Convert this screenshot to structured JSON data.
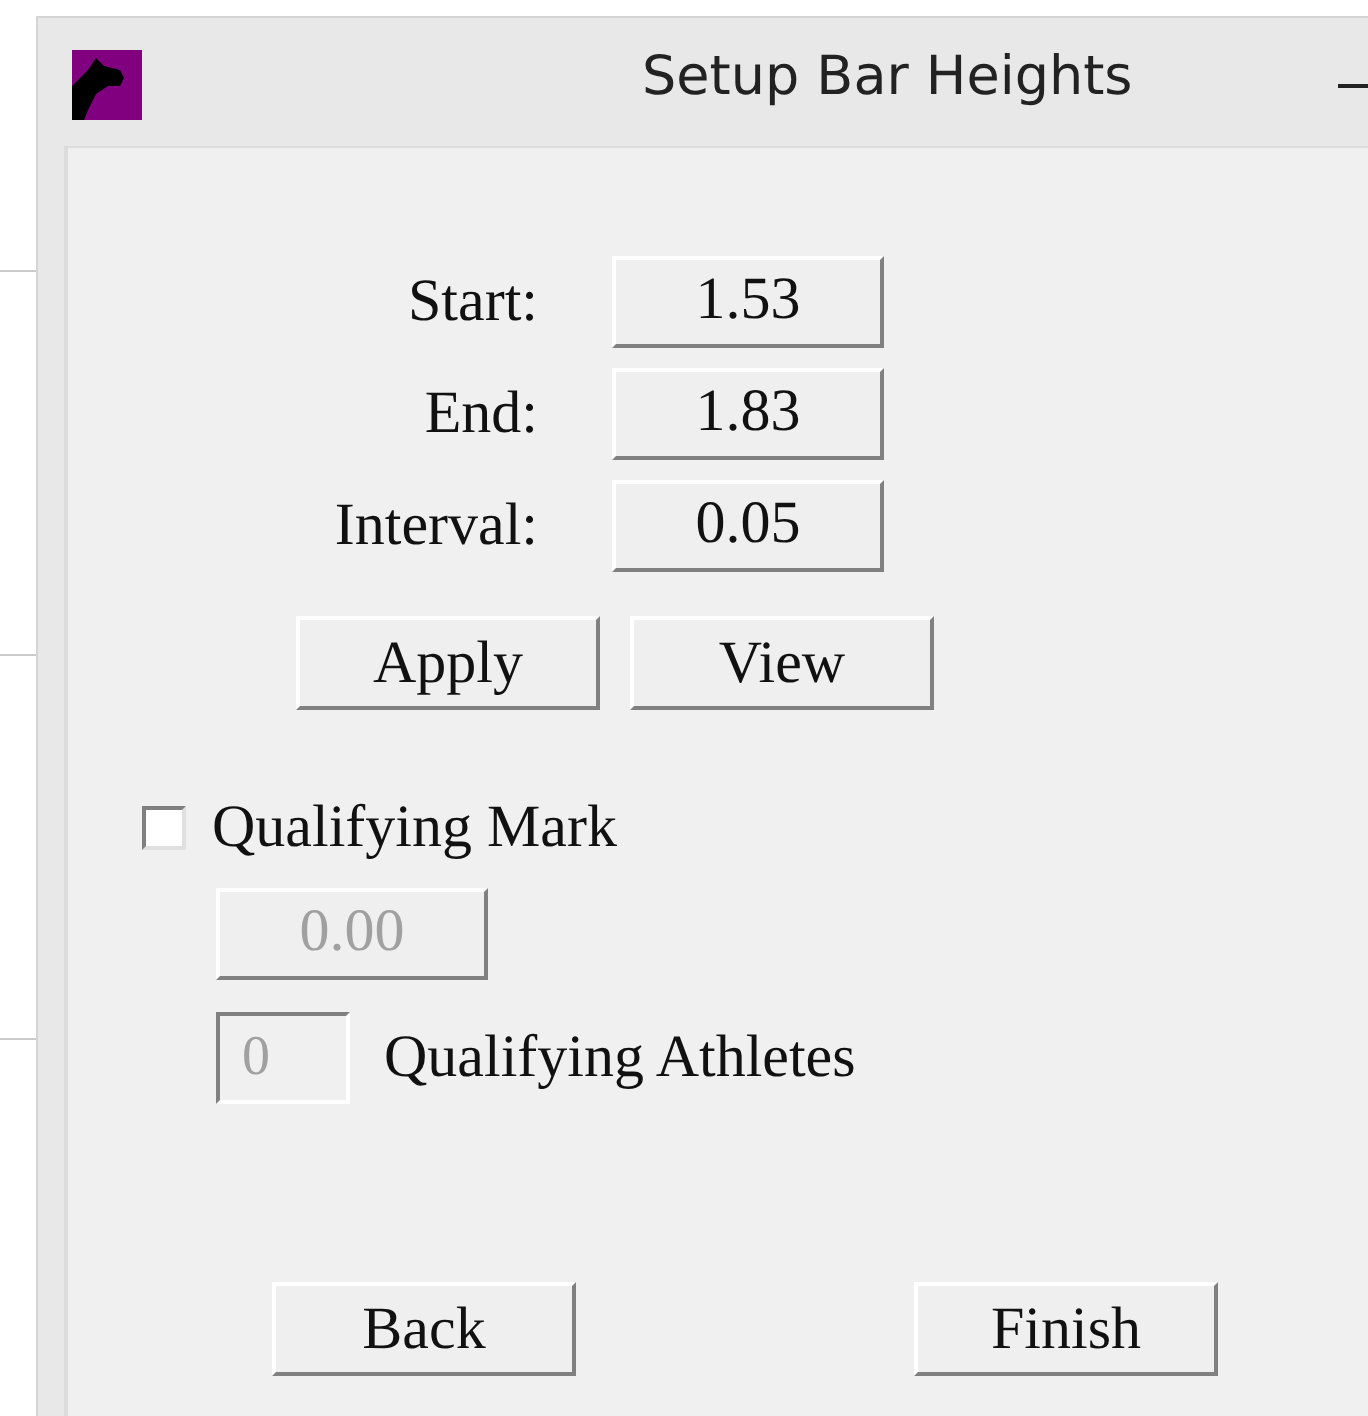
{
  "window": {
    "title": "Setup Bar Heights"
  },
  "fields": [
    {
      "label": "Start:",
      "value": "1.53"
    },
    {
      "label": "End:",
      "value": "1.83"
    },
    {
      "label": "Interval:",
      "value": "0.05"
    }
  ],
  "actions": [
    "Apply",
    "View"
  ],
  "qualifying_mark": {
    "label": "Qualifying Mark",
    "checked": false,
    "value": "0.00",
    "disabled": true
  },
  "qualifying_athletes": {
    "value": "0",
    "label": "Qualifying Athletes",
    "disabled": true
  },
  "buttons": [
    "Back",
    "Finish"
  ]
}
